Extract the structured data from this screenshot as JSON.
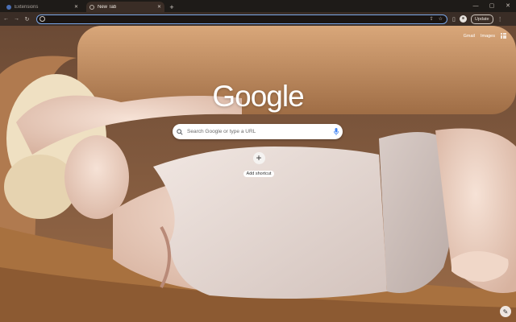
{
  "tabs": [
    {
      "label": "Extensions",
      "state": "inactive"
    },
    {
      "label": "New Tab",
      "state": "active"
    }
  ],
  "window_controls": {
    "minimize": "—",
    "maximize": "▢",
    "close": "✕"
  },
  "toolbar": {
    "back": "←",
    "forward": "→",
    "reload": "↻",
    "omnibox_value": "",
    "update_label": "Update",
    "menu": "⋮"
  },
  "ntp": {
    "gmail_label": "Gmail",
    "images_label": "Images",
    "logo_text": "Google",
    "search_placeholder": "Search Google or type a URL",
    "shortcut_plus": "+",
    "shortcut_label": "Add shortcut"
  },
  "colors": {
    "omnibox_focus": "#7aa7e8",
    "tab_active_bg": "#3a2d26",
    "tabstrip_bg": "#1e1b18"
  },
  "icons": [
    "lock-icon",
    "share-icon",
    "star-icon",
    "sidebar-icon",
    "profile-avatar-icon",
    "apps-grid-icon",
    "search-icon",
    "mic-icon",
    "pencil-icon"
  ]
}
